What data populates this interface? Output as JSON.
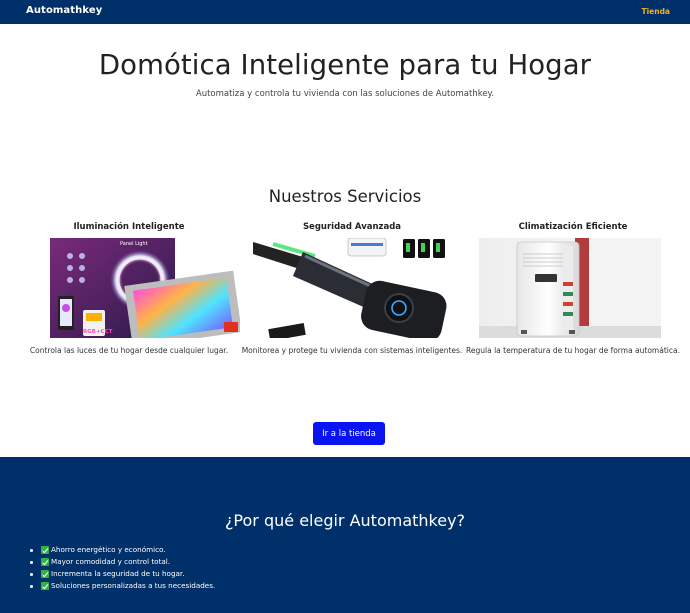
{
  "navbar": {
    "brand": "Automathkey",
    "link": "Tienda"
  },
  "hero": {
    "title": "Domótica Inteligente para tu Hogar",
    "subtitle": "Automatiza y controla tu vivienda con las soluciones de Automathkey."
  },
  "services": {
    "title": "Nuestros Servicios",
    "items": [
      {
        "title": "Iluminación Inteligente",
        "desc": "Controla las luces de tu hogar desde cualquier lugar.",
        "image": "smart-panel-light-image",
        "image_text_1": "Panel Light",
        "image_text_2": "RGB+CCT"
      },
      {
        "title": "Seguridad Avanzada",
        "desc": "Monitorea y protege tu vivienda con sistemas inteligentes.",
        "image": "smart-lock-image"
      },
      {
        "title": "Climatización Eficiente",
        "desc": "Regula la temperatura de tu hogar de forma automática.",
        "image": "portable-air-conditioner-image"
      }
    ]
  },
  "cta": {
    "label": "Ir a la tienda"
  },
  "why": {
    "title": "¿Por qué elegir Automathkey?",
    "items": [
      "Ahorro energético y económico.",
      "Mayor comodidad y control total.",
      "Incrementa la seguridad de tu hogar.",
      "Soluciones personalizadas a tus necesidades."
    ]
  },
  "colors": {
    "navbar": "#00306a",
    "accent": "#f2b01e",
    "button": "#0a14f0",
    "check": "#2fb344"
  }
}
